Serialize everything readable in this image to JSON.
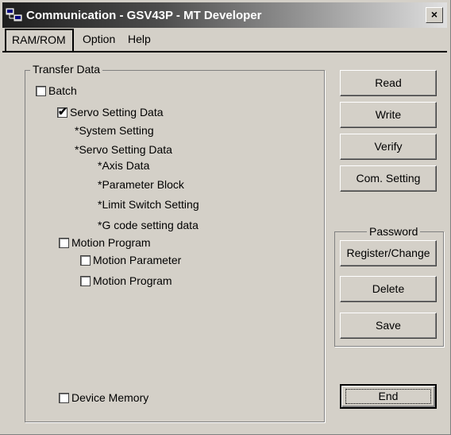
{
  "window": {
    "title": "Communication - GSV43P - MT Developer",
    "close_label": "×"
  },
  "menu": {
    "items": [
      "RAM/ROM",
      "Option",
      "Help"
    ]
  },
  "transfer_data": {
    "group_title": "Transfer Data",
    "batch": {
      "label": "Batch",
      "checked": false
    },
    "servo_setting_data": {
      "label": "Servo Setting Data",
      "checked": true
    },
    "servo_subitems": [
      "*System Setting",
      "*Servo Setting Data"
    ],
    "servo_detail_items": [
      "*Axis Data",
      "*Parameter Block",
      "*Limit Switch Setting",
      "*G code setting data"
    ],
    "motion_program": {
      "label": "Motion Program",
      "checked": false
    },
    "motion_parameter": {
      "label": "Motion Parameter",
      "checked": false
    },
    "motion_program_sub": {
      "label": "Motion Program",
      "checked": false
    },
    "device_memory": {
      "label": "Device Memory",
      "checked": false
    }
  },
  "buttons": {
    "read": "Read",
    "write": "Write",
    "verify": "Verify",
    "com_setting": "Com. Setting",
    "end": "End"
  },
  "password": {
    "group_title": "Password",
    "register_change": "Register/Change",
    "delete": "Delete",
    "save": "Save"
  }
}
